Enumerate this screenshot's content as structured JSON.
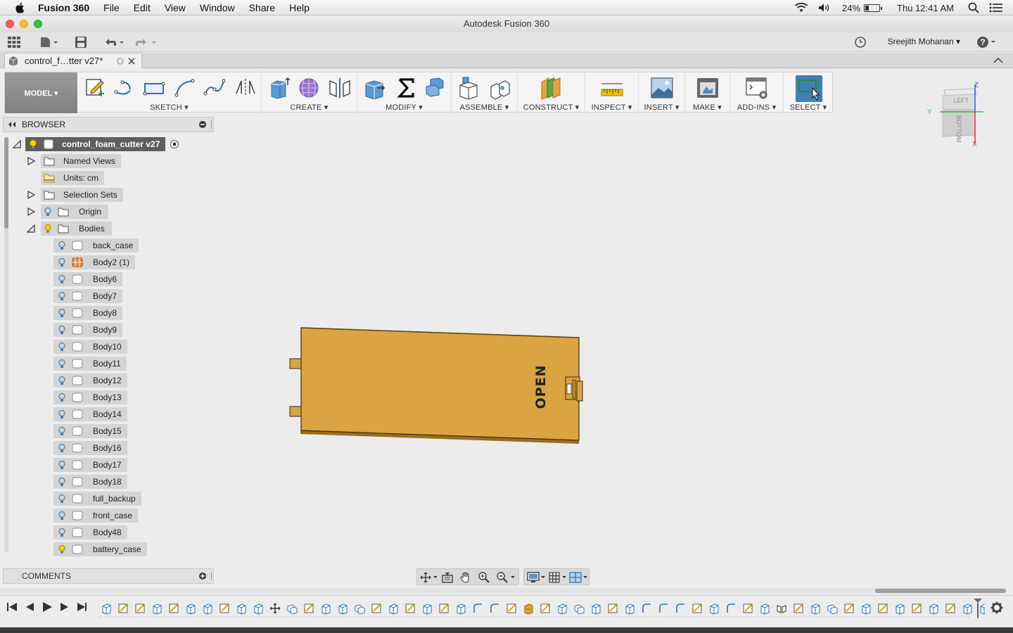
{
  "menubar": {
    "app_name": "Fusion 360",
    "items": [
      "File",
      "Edit",
      "View",
      "Window",
      "Share",
      "Help"
    ],
    "battery": "24%",
    "battery_fraction": 0.24,
    "clock": "Thu 12:41 AM"
  },
  "window": {
    "title": "Autodesk Fusion 360"
  },
  "qat": {
    "user": "Sreejith Mohanan ▾"
  },
  "tab": {
    "label": "control_f…tter v27*"
  },
  "toolbar": {
    "workspace": "MODEL ▾",
    "groups": {
      "sketch": "SKETCH ▾",
      "create": "CREATE ▾",
      "modify": "MODIFY ▾",
      "assemble": "ASSEMBLE ▾",
      "construct": "CONSTRUCT ▾",
      "inspect": "INSPECT ▾",
      "insert": "INSERT ▾",
      "make": "MAKE ▾",
      "addins": "ADD-INS ▾",
      "select": "SELECT ▾"
    }
  },
  "viewcube": {
    "face_left": "LEFT",
    "face_bottom": "BOTTOM",
    "axis_z": "Z",
    "axis_y": "Y",
    "axis_x": "X"
  },
  "browser": {
    "title": "BROWSER",
    "root": "control_foam_cutter v27",
    "nodes": {
      "named_views": "Named Views",
      "units": "Units: cm",
      "selection_sets": "Selection Sets",
      "origin": "Origin",
      "bodies": "Bodies"
    },
    "bodies": [
      "back_case",
      "Body2 (1)",
      "Body6",
      "Body7",
      "Body8",
      "Body9",
      "Body10",
      "Body11",
      "Body12",
      "Body13",
      "Body14",
      "Body15",
      "Body16",
      "Body17",
      "Body18",
      "full_backup",
      "front_case",
      "Body48",
      "battery_case"
    ]
  },
  "viewport": {
    "model_text": "OPEN",
    "model_color": "#d9a441"
  },
  "comments": {
    "title": "COMMENTS"
  },
  "colors": {
    "accent": "#3f7fb8",
    "toolbar_bg": "#f4f4f4",
    "viewport_bg": "#ececec"
  }
}
